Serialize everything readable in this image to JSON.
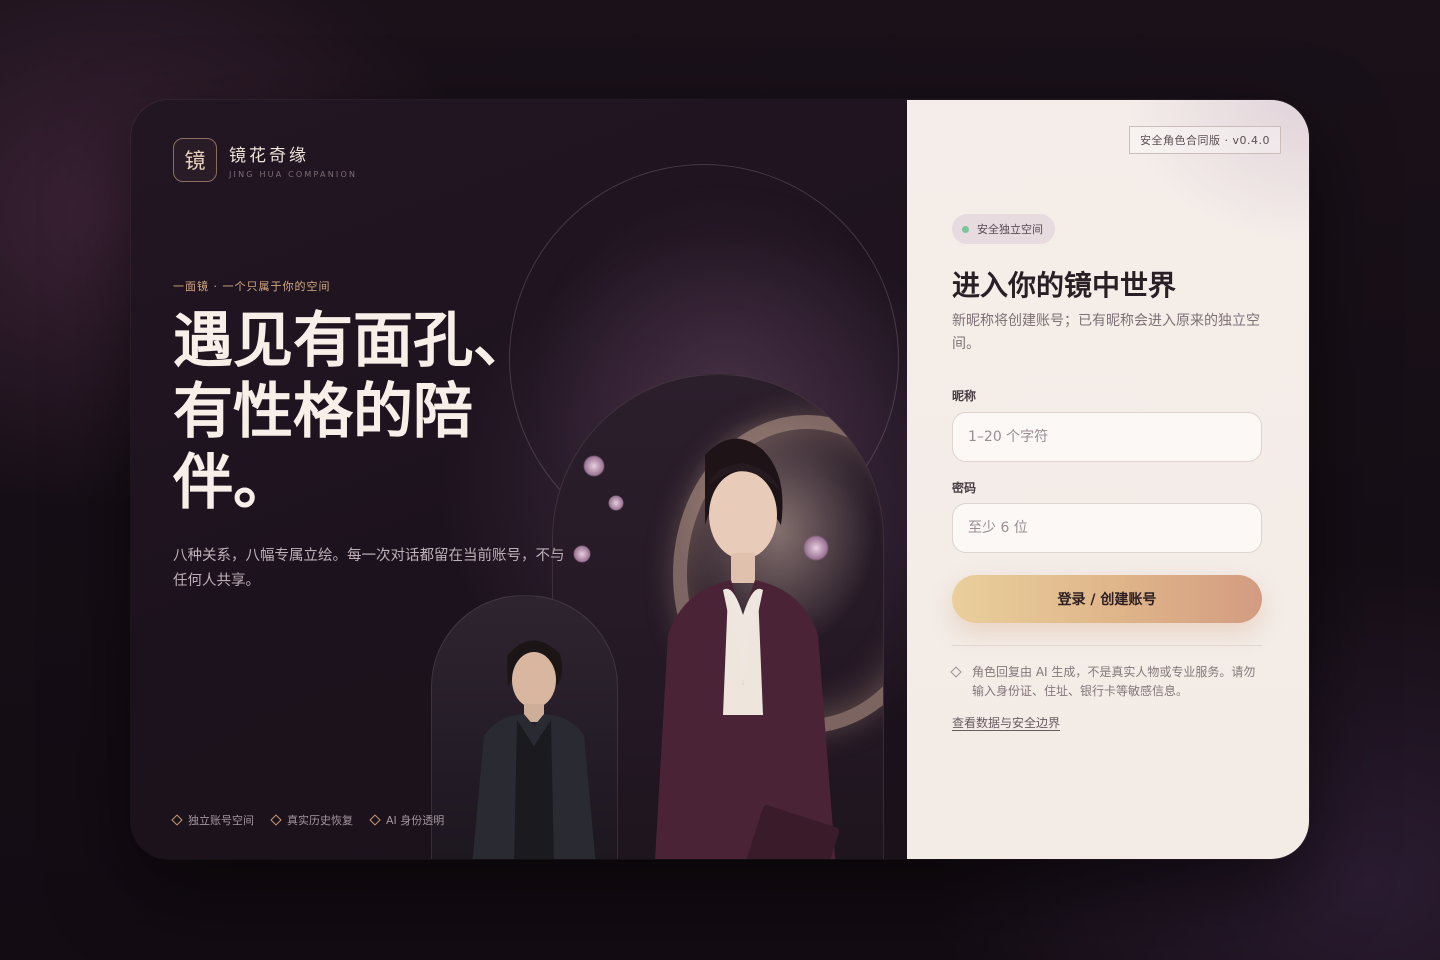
{
  "brand": {
    "mark": "镜",
    "name": "镜花奇缘",
    "subtitle": "JING HUA COMPANION"
  },
  "hero": {
    "eyebrow": "一面镜 · 一个只属于你的空间",
    "headline": "遇见有面孔、有性格的陪伴。",
    "description": "八种关系，八幅专属立绘。每一次对话都留在当前账号，不与任何人共享。"
  },
  "features": [
    {
      "label": "独立账号空间",
      "icon": "diamond-icon"
    },
    {
      "label": "真实历史恢复",
      "icon": "diamond-icon"
    },
    {
      "label": "AI 身份透明",
      "icon": "diamond-icon"
    }
  ],
  "panel": {
    "version": "安全角色合同版 · v0.4.0",
    "badge": "安全独立空间",
    "title": "进入你的镜中世界",
    "description": "新昵称将创建账号；已有昵称会进入原来的独立空间。",
    "nickname": {
      "label": "昵称",
      "placeholder": "1–20 个字符",
      "value": ""
    },
    "password": {
      "label": "密码",
      "placeholder": "至少 6 位",
      "value": ""
    },
    "submit_label": "登录 / 创建账号",
    "notice": "角色回复由 AI 生成，不是真实人物或专业服务。请勿输入身份证、住址、银行卡等敏感信息。",
    "link_label": "查看数据与安全边界"
  },
  "colors": {
    "accent_gold": "#e0b88a",
    "status_green": "#7bc49a",
    "dark_bg": "#1c121d",
    "panel_bg": "#f4ede9"
  }
}
